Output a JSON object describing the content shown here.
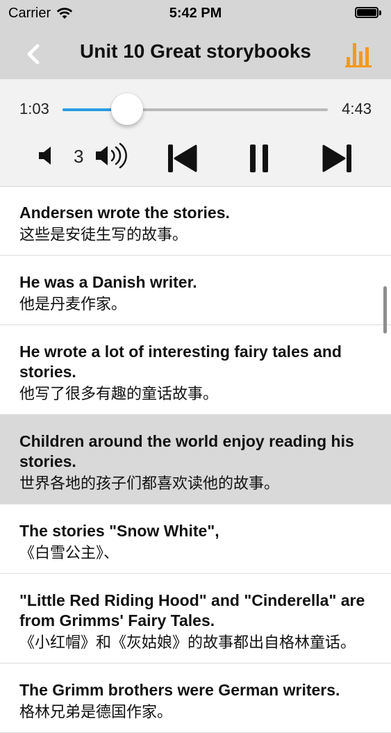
{
  "status_bar": {
    "carrier": "Carrier",
    "time": "5:42 PM"
  },
  "nav": {
    "title": "Unit 10 Great storybooks",
    "back_icon": "chevron-left-icon",
    "chart_icon": "bar-chart-icon",
    "accent_color": "#f39a1e"
  },
  "player": {
    "current_time": "1:03",
    "total_time": "4:43",
    "progress_fraction": 0.243,
    "volume": "3",
    "track_color": "#2d9be0"
  },
  "sentences": [
    {
      "en": "Andersen wrote the stories.",
      "zh": "这些是安徒生写的故事。",
      "active": false
    },
    {
      "en": "He was a Danish writer.",
      "zh": "他是丹麦作家。",
      "active": false
    },
    {
      "en": "He wrote a lot of interesting fairy tales and stories.",
      "zh": "他写了很多有趣的童话故事。",
      "active": false
    },
    {
      "en": "Children around the world enjoy reading his stories.",
      "zh": "世界各地的孩子们都喜欢读他的故事。",
      "active": true
    },
    {
      "en": "The stories \"Snow White\",",
      "zh": "《白雪公主》、",
      "active": false
    },
    {
      "en": "\"Little Red Riding Hood\" and \"Cinderella\" are from Grimms' Fairy Tales.",
      "zh": "《小红帽》和《灰姑娘》的故事都出自格林童话。",
      "active": false
    },
    {
      "en": "The Grimm brothers were German writers.",
      "zh": "格林兄弟是德国作家。",
      "active": false
    }
  ]
}
